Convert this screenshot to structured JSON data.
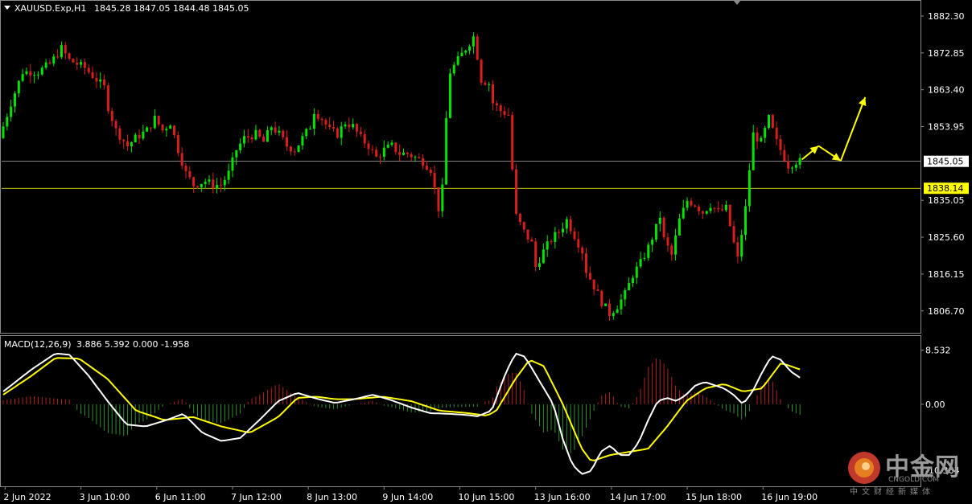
{
  "header": {
    "symbol_tf": "XAUUSD.Exp,H1",
    "ohlc": "1845.28 1847.05 1844.48 1845.05"
  },
  "colors": {
    "background": "#000000",
    "bull": "#00e400",
    "bear": "#d81e1e",
    "macd_line": "#ffffff",
    "signal_line": "#ffff00",
    "hist_pos": "#b22222",
    "hist_neg": "#2f8f2f",
    "axis_text": "#ffffff",
    "arrow": "#ffff00",
    "price_line": "#ffffff",
    "level_line": "#ffff00"
  },
  "chart_data": [
    {
      "type": "candlestick",
      "symbol": "XAUUSD.Exp",
      "timeframe": "H1",
      "ylim": [
        1801.5,
        1886.0
      ],
      "y_ticks": [
        "1882.30",
        "1872.85",
        "1863.40",
        "1853.95",
        "1845.05",
        "1838.14",
        "1835.05",
        "1825.60",
        "1816.15",
        "1806.70"
      ],
      "current_price_label": "1845.05",
      "level_label": "1838.14",
      "horizontal_lines": [
        1845.05,
        1838.14
      ],
      "x_labels": [
        "2 Jun 2022",
        "3 Jun 10:00",
        "6 Jun 11:00",
        "7 Jun 12:00",
        "8 Jun 13:00",
        "9 Jun 14:00",
        "10 Jun 15:00",
        "13 Jun 16:00",
        "14 Jun 17:00",
        "15 Jun 18:00",
        "16 Jun 19:00"
      ],
      "price_path": [
        [
          0,
          1851
        ],
        [
          3,
          1860
        ],
        [
          6,
          1868
        ],
        [
          10,
          1868
        ],
        [
          13,
          1870
        ],
        [
          16,
          1874
        ],
        [
          18,
          1871
        ],
        [
          22,
          1869
        ],
        [
          25,
          1866
        ],
        [
          27,
          1864
        ],
        [
          28,
          1859
        ],
        [
          30,
          1853
        ],
        [
          33,
          1849
        ],
        [
          35,
          1851
        ],
        [
          38,
          1853
        ],
        [
          40,
          1856
        ],
        [
          42,
          1853
        ],
        [
          44,
          1855
        ],
        [
          46,
          1848
        ],
        [
          48,
          1842
        ],
        [
          50,
          1839
        ],
        [
          53,
          1840
        ],
        [
          55,
          1839
        ],
        [
          57,
          1839
        ],
        [
          59,
          1842
        ],
        [
          61,
          1848
        ],
        [
          63,
          1851
        ],
        [
          66,
          1852
        ],
        [
          68,
          1850
        ],
        [
          70,
          1854
        ],
        [
          72,
          1852
        ],
        [
          74,
          1849
        ],
        [
          76,
          1848
        ],
        [
          78,
          1851
        ],
        [
          80,
          1854
        ],
        [
          81,
          1858
        ],
        [
          83,
          1856
        ],
        [
          85,
          1853
        ],
        [
          87,
          1852
        ],
        [
          89,
          1855
        ],
        [
          91,
          1854
        ],
        [
          93,
          1851
        ],
        [
          95,
          1849
        ],
        [
          97,
          1846
        ],
        [
          99,
          1848
        ],
        [
          101,
          1849
        ],
        [
          103,
          1847
        ],
        [
          105,
          1847
        ],
        [
          107,
          1846
        ],
        [
          109,
          1845
        ],
        [
          111,
          1843
        ],
        [
          112,
          1838
        ],
        [
          113,
          1833
        ],
        [
          114,
          1838
        ],
        [
          115,
          1856
        ],
        [
          116,
          1868
        ],
        [
          118,
          1871
        ],
        [
          120,
          1874
        ],
        [
          122,
          1877
        ],
        [
          123,
          1872
        ],
        [
          124,
          1866
        ],
        [
          126,
          1865
        ],
        [
          127,
          1860
        ],
        [
          129,
          1858
        ],
        [
          131,
          1857
        ],
        [
          132,
          1843
        ],
        [
          133,
          1831
        ],
        [
          135,
          1827
        ],
        [
          137,
          1824
        ],
        [
          138,
          1818
        ],
        [
          140,
          1822
        ],
        [
          142,
          1825
        ],
        [
          144,
          1827
        ],
        [
          146,
          1830
        ],
        [
          148,
          1826
        ],
        [
          150,
          1822
        ],
        [
          151,
          1817
        ],
        [
          153,
          1813
        ],
        [
          155,
          1809
        ],
        [
          157,
          1806
        ],
        [
          159,
          1808
        ],
        [
          161,
          1811
        ],
        [
          163,
          1816
        ],
        [
          165,
          1819
        ],
        [
          167,
          1823
        ],
        [
          169,
          1828
        ],
        [
          170,
          1831
        ],
        [
          171,
          1825
        ],
        [
          173,
          1821
        ],
        [
          175,
          1830
        ],
        [
          177,
          1835
        ],
        [
          179,
          1834
        ],
        [
          181,
          1832
        ],
        [
          183,
          1834
        ],
        [
          185,
          1832
        ],
        [
          187,
          1833
        ],
        [
          189,
          1824
        ],
        [
          190,
          1820
        ],
        [
          192,
          1833
        ],
        [
          193,
          1843
        ],
        [
          194,
          1852
        ],
        [
          196,
          1850
        ],
        [
          197,
          1853
        ],
        [
          198,
          1856
        ],
        [
          200,
          1850
        ],
        [
          202,
          1846
        ],
        [
          203,
          1844
        ],
        [
          205,
          1845
        ]
      ],
      "projection_arrows": [
        {
          "from": [
            1845.05,
            "now"
          ],
          "to": "up-right",
          "label": ""
        },
        {
          "from": "peak",
          "to": "down-right",
          "label": ""
        },
        {
          "from": "trough",
          "to": "up-right",
          "label": ""
        }
      ]
    },
    {
      "type": "line+bar",
      "title": "MACD(12,26,9)",
      "values_text": "3.886 5.392 0.000 -1.958",
      "ylim": [
        -12.8,
        10.5
      ],
      "y_ticks": [
        "8.532",
        "0.00",
        "-10.364"
      ],
      "macd_path": [
        [
          0,
          2.0
        ],
        [
          6,
          5.5
        ],
        [
          11,
          8.0
        ],
        [
          14,
          7.8
        ],
        [
          18,
          4.5
        ],
        [
          22,
          0.5
        ],
        [
          26,
          -3.2
        ],
        [
          30,
          -3.5
        ],
        [
          34,
          -2.6
        ],
        [
          38,
          -1.5
        ],
        [
          42,
          -4.5
        ],
        [
          46,
          -5.8
        ],
        [
          50,
          -5.3
        ],
        [
          54,
          -2.5
        ],
        [
          58,
          0.5
        ],
        [
          62,
          1.8
        ],
        [
          66,
          0.9
        ],
        [
          70,
          0.2
        ],
        [
          74,
          0.8
        ],
        [
          78,
          1.5
        ],
        [
          82,
          0.6
        ],
        [
          86,
          -0.5
        ],
        [
          90,
          -1.4
        ],
        [
          94,
          -1.5
        ],
        [
          98,
          -1.7
        ],
        [
          100,
          -1.9
        ],
        [
          103,
          -1.0
        ],
        [
          106,
          5.0
        ],
        [
          108,
          8.0
        ],
        [
          110,
          7.5
        ],
        [
          112,
          5.0
        ],
        [
          116,
          0.0
        ],
        [
          118,
          -5.5
        ],
        [
          120,
          -9.5
        ],
        [
          122,
          -11.0
        ],
        [
          124,
          -10.5
        ],
        [
          126,
          -7.5
        ],
        [
          128,
          -6.5
        ],
        [
          130,
          -8.0
        ],
        [
          132,
          -8.0
        ],
        [
          134,
          -6.0
        ],
        [
          136,
          -2.5
        ],
        [
          138,
          0.5
        ],
        [
          140,
          1.0
        ],
        [
          142,
          0.5
        ],
        [
          144,
          1.5
        ],
        [
          146,
          3.0
        ],
        [
          148,
          3.5
        ],
        [
          150,
          3.0
        ],
        [
          152,
          2.5
        ],
        [
          154,
          1.5
        ],
        [
          156,
          0.0
        ],
        [
          158,
          2.0
        ],
        [
          160,
          5.0
        ],
        [
          162,
          7.6
        ],
        [
          164,
          7.0
        ],
        [
          166,
          5.2
        ],
        [
          168,
          4.2
        ]
      ],
      "signal_path": [
        [
          0,
          1.5
        ],
        [
          6,
          4.5
        ],
        [
          11,
          7.3
        ],
        [
          16,
          7.2
        ],
        [
          22,
          4.0
        ],
        [
          28,
          -1.0
        ],
        [
          34,
          -2.5
        ],
        [
          40,
          -2.0
        ],
        [
          46,
          -3.5
        ],
        [
          52,
          -4.5
        ],
        [
          58,
          -2.0
        ],
        [
          62,
          1.0
        ],
        [
          66,
          1.2
        ],
        [
          70,
          0.8
        ],
        [
          74,
          0.8
        ],
        [
          80,
          1.2
        ],
        [
          86,
          0.5
        ],
        [
          92,
          -1.0
        ],
        [
          98,
          -1.4
        ],
        [
          102,
          -1.8
        ],
        [
          104,
          -1.0
        ],
        [
          108,
          4.0
        ],
        [
          111,
          7.0
        ],
        [
          114,
          6.0
        ],
        [
          118,
          0.0
        ],
        [
          122,
          -7.0
        ],
        [
          124,
          -9.0
        ],
        [
          128,
          -8.0
        ],
        [
          132,
          -7.5
        ],
        [
          136,
          -7.0
        ],
        [
          140,
          -3.5
        ],
        [
          144,
          0.5
        ],
        [
          148,
          2.5
        ],
        [
          152,
          3.2
        ],
        [
          156,
          2.0
        ],
        [
          160,
          2.5
        ],
        [
          164,
          6.5
        ],
        [
          168,
          5.5
        ]
      ],
      "histogram_pos_ranges": [
        [
          0,
          15
        ],
        [
          26,
          44
        ],
        [
          56,
          88
        ],
        [
          104,
          116
        ],
        [
          140,
          150
        ],
        [
          155,
          160
        ],
        [
          176,
          182
        ]
      ],
      "histogram_neg_ranges": [
        [
          15,
          26
        ],
        [
          44,
          56
        ],
        [
          88,
          104
        ],
        [
          116,
          140
        ],
        [
          150,
          155
        ],
        [
          160,
          176
        ],
        [
          182,
          205
        ]
      ]
    }
  ],
  "watermark": {
    "brand_cn": "中金网",
    "url": "CNGOLD.COM",
    "sub_cn": "中文财经新媒体"
  }
}
